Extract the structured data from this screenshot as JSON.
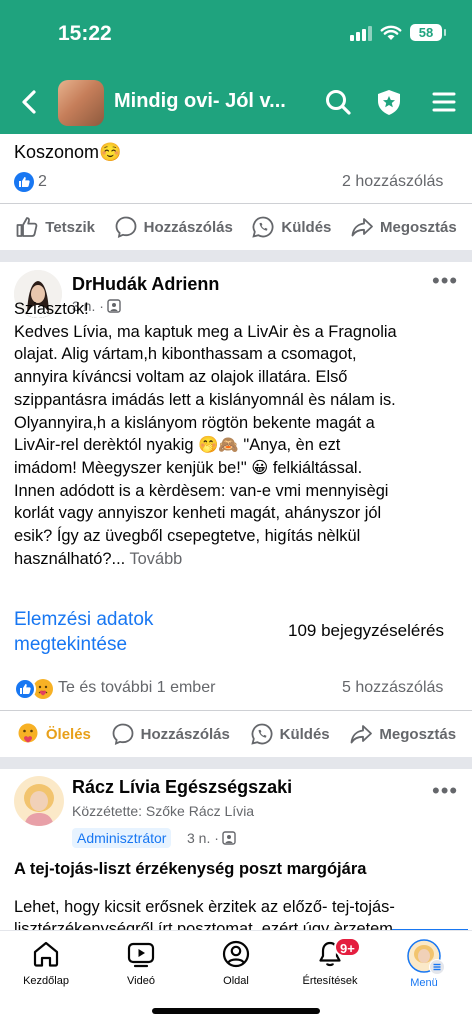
{
  "status_bar": {
    "time": "15:22",
    "battery": "58"
  },
  "header": {
    "title": "Mindig ovi- Jól v..."
  },
  "prev_post": {
    "comment_text": "Koszonom☺️",
    "reaction_count": "2",
    "comment_count": "2 hozzászólás",
    "actions": {
      "like": "Tetszik",
      "comment": "Hozzászólás",
      "send": "Küldés",
      "share": "Megosztás"
    }
  },
  "post": {
    "author": "DrHudák Adrienn",
    "time": "3 n. ·",
    "text_lines": [
      "Sziasztok!",
      "Kedves Lívia, ma kaptuk meg a LivAir ès a Fragnolia",
      "olajat.  Alig vártam,h kibonthassam a csomagot,",
      "annyira kíváncsi voltam az olajok illatára. Első",
      "szippantásra imádás lett a kislányomnál ès nálam is.",
      "Olyannyira,h a kislányom rögtön bekente magát a",
      "LivAir-rel derèktól nyakig 🤭🙈 \"Anya, èn ezt",
      "imádom! Mèegyszer kenjük be!\" 😀 felkiáltással.",
      "Innen adódott is a kèrdèsem: van-e vmi mennyisègi",
      "korlát vagy annyiszor kenheti magát, ahányszor jól",
      "esik? Így az üvegből csepegtetve, higítás nèlkül",
      "használható?..."
    ],
    "see_more": " Tovább",
    "insights_link_line1": "Elemzési adatok",
    "insights_link_line2": "megtekintése",
    "reach": "109 bejegyzéselérés",
    "reactions_text": "Te és további 1 ember",
    "comment_count": "5 hozzászólás",
    "actions": {
      "react": "Ölelés",
      "comment": "Hozzászólás",
      "send": "Küldés",
      "share": "Megosztás"
    }
  },
  "next_post": {
    "author": "Rácz Lívia Egészségszaki",
    "posted_by": "Közzétette: Szőke Rácz Lívia",
    "badge": "Adminisztrátor",
    "time": "3 n. ·",
    "title": "A tej-tojás-liszt érzékenység poszt margójára",
    "text_line1": "Lehet, hogy kicsit erősnek èrzitek az előző- tej-tojás-",
    "text_line2": "lisztérzékenységről írt posztomat, ezért úgy èrzetem"
  },
  "tabbar": {
    "home": "Kezdőlap",
    "video": "Videó",
    "page": "Oldal",
    "notifications": "Értesítések",
    "notifications_badge": "9+",
    "menu": "Menü"
  },
  "colors": {
    "header": "#1fa37e",
    "link": "#1877f2",
    "care": "#f7b125"
  }
}
